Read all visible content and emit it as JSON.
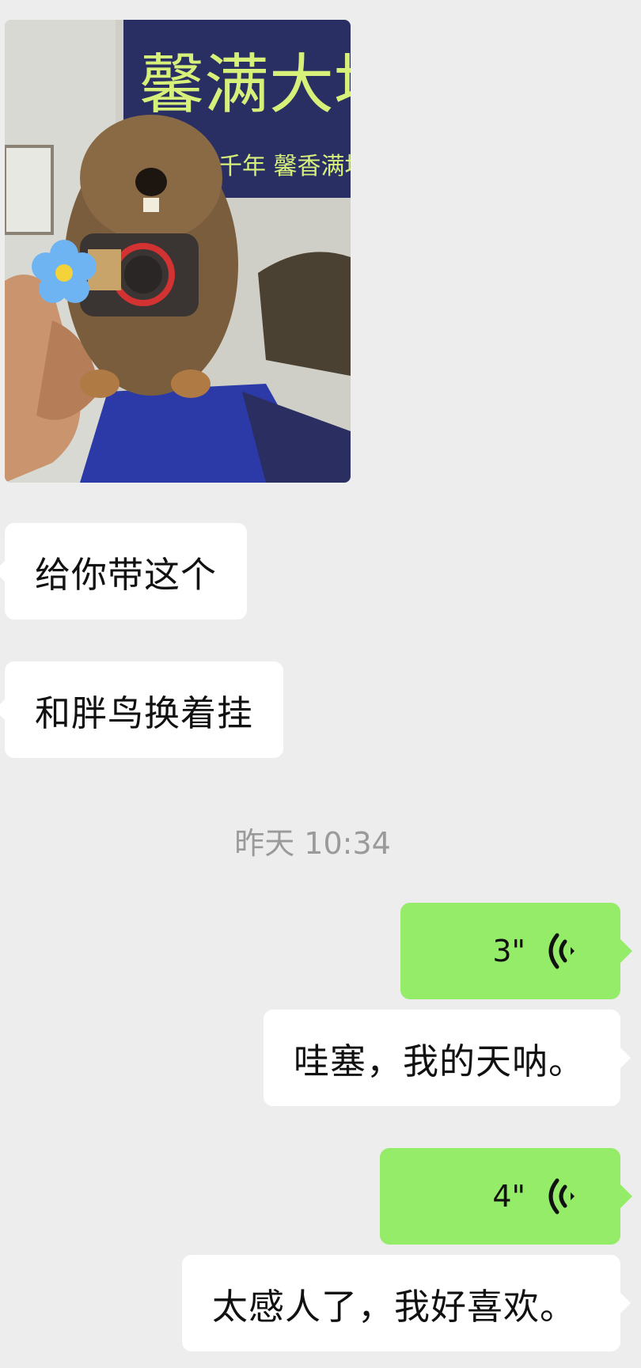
{
  "photo": {
    "sign_text_large": "馨满大地",
    "sign_text_small": "千年 馨香满地",
    "description_icon": "image-message"
  },
  "messages": [
    {
      "side": "left",
      "type": "text",
      "text": "给你带这个"
    },
    {
      "side": "left",
      "type": "text",
      "text": "和胖鸟换着挂"
    },
    {
      "side": "right",
      "type": "voice",
      "duration": "3\""
    },
    {
      "side": "right",
      "type": "text",
      "text": "哇塞，我的天呐。"
    },
    {
      "side": "right",
      "type": "voice",
      "duration": "4\""
    },
    {
      "side": "right",
      "type": "text",
      "text": "太感人了，我好喜欢。"
    }
  ],
  "timestamp": "昨天 10:34",
  "colors": {
    "background": "#ededed",
    "incoming_bubble": "#ffffff",
    "outgoing_voice_bubble": "#95ec69",
    "timestamp_text": "#9a9a9a"
  },
  "icons": {
    "voice": "voice-wave-icon",
    "flower": "flower-sticker-icon"
  }
}
